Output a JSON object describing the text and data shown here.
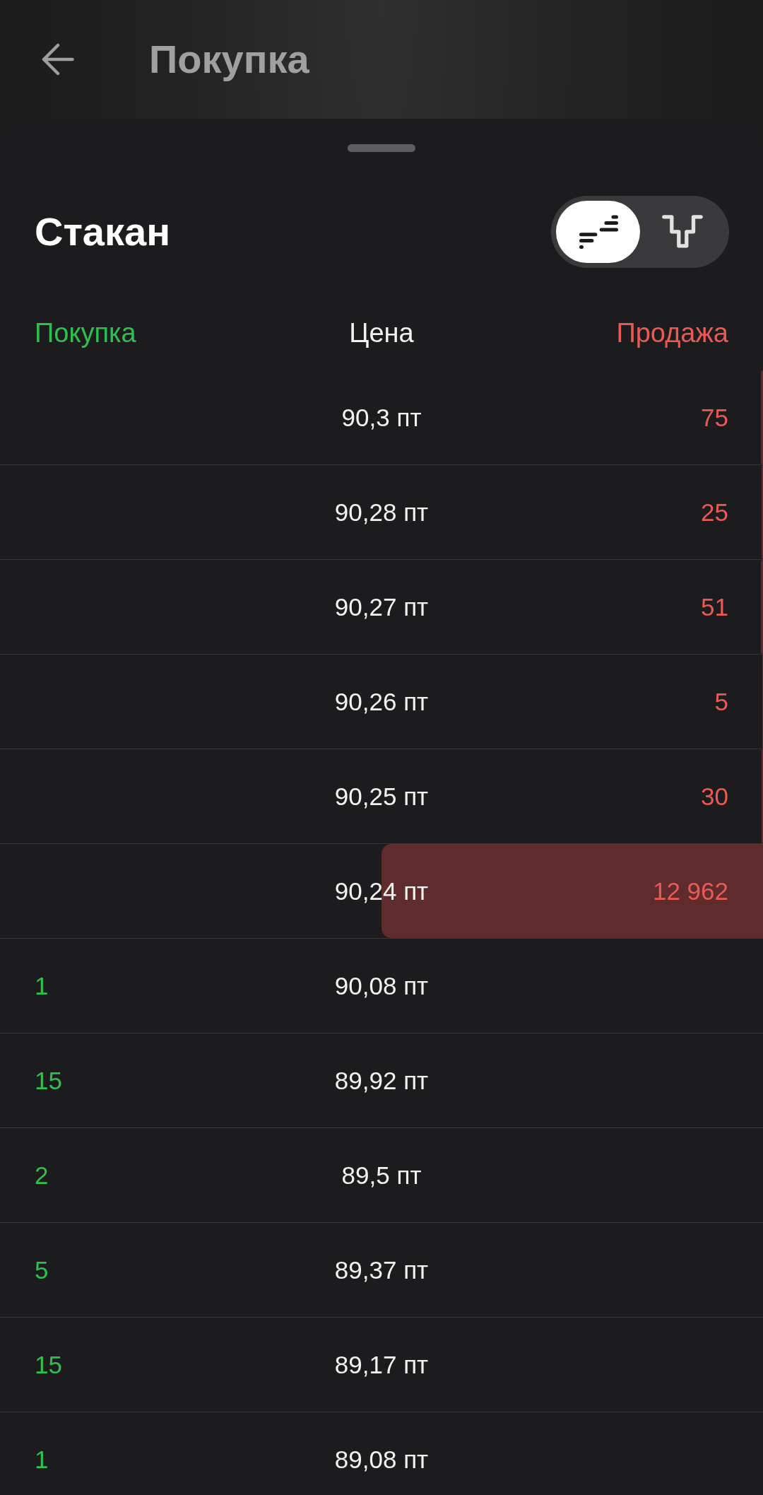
{
  "header": {
    "title": "Покупка"
  },
  "order_book": {
    "title": "Стакан",
    "view_toggle": [
      {
        "kind": "orderbook",
        "selected": true
      },
      {
        "kind": "depth",
        "selected": false
      }
    ],
    "columns": {
      "buy": "Покупка",
      "price": "Цена",
      "sell": "Продажа"
    },
    "rows": [
      {
        "kind": "sell",
        "price": "90,3 пт",
        "quantity": "75",
        "level": 0.003
      },
      {
        "kind": "sell",
        "price": "90,28 пт",
        "quantity": "25",
        "level": 0.002
      },
      {
        "kind": "sell",
        "price": "90,27 пт",
        "quantity": "51",
        "level": 0.003
      },
      {
        "kind": "sell",
        "price": "90,26 пт",
        "quantity": "5",
        "level": 0.001
      },
      {
        "kind": "sell",
        "price": "90,25 пт",
        "quantity": "30",
        "level": 0.002
      },
      {
        "kind": "sell",
        "price": "90,24 пт",
        "quantity": "12 962",
        "level": 0.5
      },
      {
        "kind": "buy",
        "price": "90,08 пт",
        "quantity": "1"
      },
      {
        "kind": "buy",
        "price": "89,92 пт",
        "quantity": "15"
      },
      {
        "kind": "buy",
        "price": "89,5 пт",
        "quantity": "2"
      },
      {
        "kind": "buy",
        "price": "89,37 пт",
        "quantity": "5"
      },
      {
        "kind": "buy",
        "price": "89,17 пт",
        "quantity": "15"
      },
      {
        "kind": "buy",
        "price": "89,08 пт",
        "quantity": "1"
      }
    ]
  }
}
